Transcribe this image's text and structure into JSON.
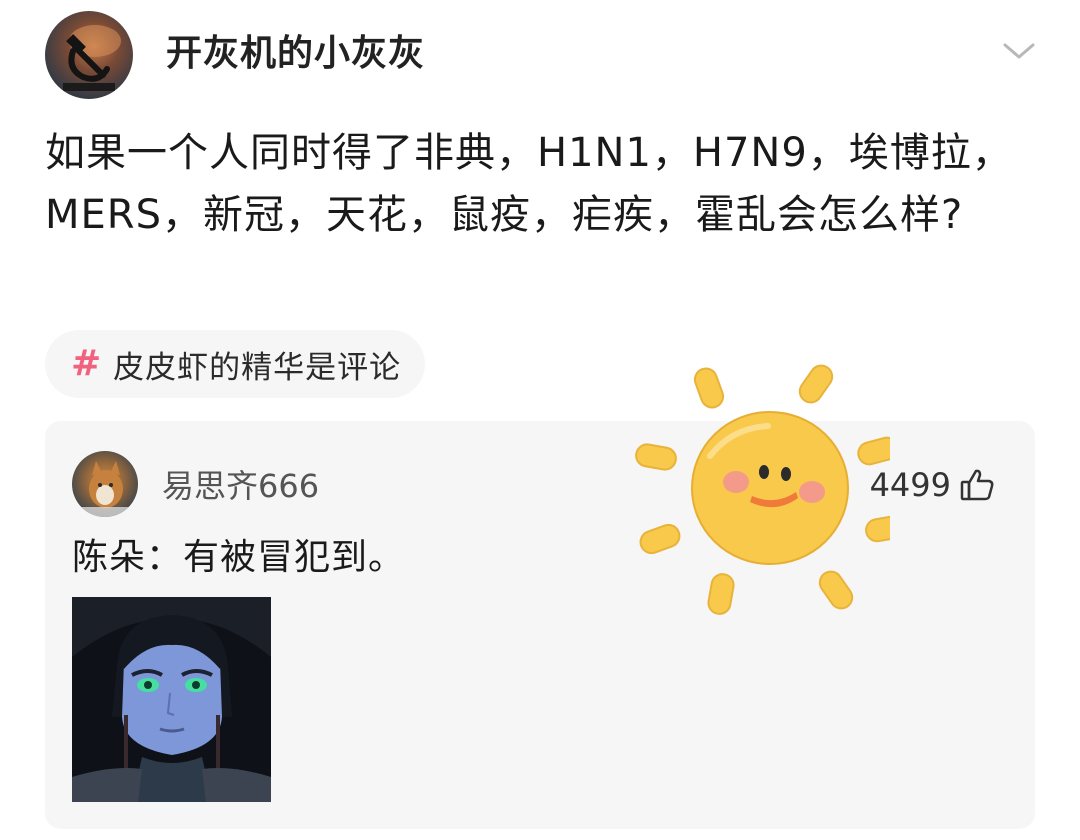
{
  "post": {
    "author": "开灰机的小灰灰",
    "title": "如果一个人同时得了非典，H1N1，H7N9，埃博拉，MERS，新冠，天花，鼠疫，疟疾，霍乱会怎么样?",
    "tag": {
      "symbol": "#",
      "label": "皮皮虾的精华是评论"
    }
  },
  "comment": {
    "user": "易思齐666",
    "likes": "4499",
    "text": "陈朵：有被冒犯到。"
  },
  "icons": {
    "expand": "chevron-down-icon",
    "like": "thumbs-up-icon",
    "sticker": "sun-sticker"
  },
  "colors": {
    "tag_hash": "#f0627e",
    "card_bg": "#f6f6f7",
    "sun": "#f8c94a"
  }
}
